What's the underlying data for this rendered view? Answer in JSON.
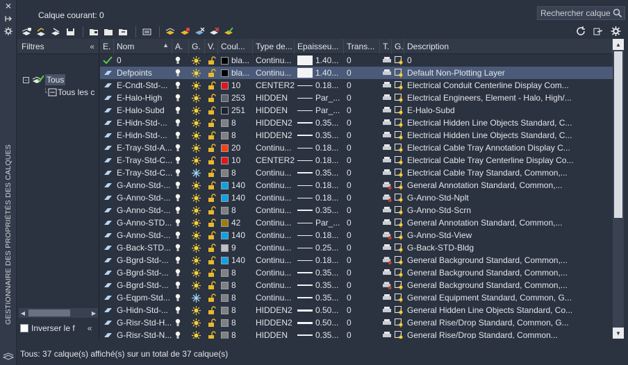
{
  "window": {
    "side_title": "GESTIONNAIRE DES PROPRIÉTÉS DES CALQUES",
    "current_layer_label": "Calque courant: 0",
    "search_placeholder": "Rechercher calque"
  },
  "filters": {
    "title": "Filtres",
    "tree": [
      {
        "label": "Tous",
        "selected": true
      },
      {
        "label": "Tous les c",
        "selected": false
      }
    ],
    "invert_label": "Inverser  le f"
  },
  "columns": [
    {
      "key": "status",
      "label": "E."
    },
    {
      "key": "name",
      "label": "Nom"
    },
    {
      "key": "on",
      "label": "A."
    },
    {
      "key": "freeze",
      "label": "G."
    },
    {
      "key": "lock",
      "label": "V."
    },
    {
      "key": "color",
      "label": "Coul..."
    },
    {
      "key": "linetype",
      "label": "Type de..."
    },
    {
      "key": "lineweight",
      "label": "Epaisseu..."
    },
    {
      "key": "transparency",
      "label": "Trans..."
    },
    {
      "key": "plot",
      "label": "T."
    },
    {
      "key": "newvp",
      "label": "G."
    },
    {
      "key": "description",
      "label": "Description"
    }
  ],
  "layers": [
    {
      "status": "current",
      "name": "0",
      "color_label": "bla...",
      "color": "#000000",
      "linetype": "Continu...",
      "lw": "1.40...",
      "lw_style": "box",
      "trans": "0",
      "plot_red": false,
      "desc": "0",
      "frozen": false
    },
    {
      "status": "layer",
      "name": "Defpoints",
      "color_label": "bla...",
      "color": "#000000",
      "linetype": "Continu...",
      "lw": "1.40...",
      "lw_style": "box",
      "trans": "0",
      "plot_red": false,
      "desc": "Default Non-Plotting Layer",
      "frozen": false,
      "selected": true
    },
    {
      "status": "layer",
      "name": "E-Cndt-Std-...",
      "color_label": "10",
      "color": "#e0151c",
      "linetype": "CENTER2",
      "lw": "0.18...",
      "lw_style": "thin",
      "trans": "0",
      "plot_red": false,
      "desc": "Electrical Conduit Centerline Display Com...",
      "frozen": false
    },
    {
      "status": "layer",
      "name": "E-Halo-High",
      "color_label": "253",
      "color": "#5e6470",
      "linetype": "HIDDEN",
      "lw": "Par_...",
      "lw_style": "thin",
      "trans": "0",
      "plot_red": false,
      "desc": "Electrical Engineers, Element - Halo, High/...",
      "frozen": false
    },
    {
      "status": "layer",
      "name": "E-Halo-Subd",
      "color_label": "251",
      "color": "#1e232b",
      "linetype": "HIDDEN",
      "lw": "Par_...",
      "lw_style": "thin",
      "trans": "0",
      "plot_red": false,
      "desc": "E-Halo-Subd",
      "frozen": false
    },
    {
      "status": "layer",
      "name": "E-Hidn-Std-...",
      "color_label": "8",
      "color": "#808080",
      "linetype": "HIDDEN2",
      "lw": "0.35...",
      "lw_style": "med",
      "trans": "0",
      "plot_red": false,
      "desc": "Electrical Hidden Line Objects Standard, C...",
      "frozen": false
    },
    {
      "status": "layer",
      "name": "E-Hidn-Std-...",
      "color_label": "8",
      "color": "#808080",
      "linetype": "HIDDEN2",
      "lw": "0.35...",
      "lw_style": "med",
      "trans": "0",
      "plot_red": false,
      "desc": "Electrical Hidden Line Objects Standard, C...",
      "frozen": false
    },
    {
      "status": "layer",
      "name": "E-Tray-Std-A...",
      "color_label": "20",
      "color": "#ff3f0f",
      "linetype": "Continu...",
      "lw": "0.18...",
      "lw_style": "thin",
      "trans": "0",
      "plot_red": false,
      "desc": "Electrical Cable Tray Annotation Display C...",
      "frozen": false
    },
    {
      "status": "layer",
      "name": "E-Tray-Std-C...",
      "color_label": "10",
      "color": "#e0151c",
      "linetype": "CENTER2",
      "lw": "0.18...",
      "lw_style": "thin",
      "trans": "0",
      "plot_red": false,
      "desc": "Electrical Cable Tray Centerline Display Co...",
      "frozen": false
    },
    {
      "status": "layer",
      "name": "E-Tray-Std-C...",
      "color_label": "8",
      "color": "#808080",
      "linetype": "Continu...",
      "lw": "0.35...",
      "lw_style": "med",
      "trans": "0",
      "plot_red": false,
      "desc": "Electrical Cable Tray Standard, Common,...",
      "frozen": true
    },
    {
      "status": "layer",
      "name": "G-Anno-Std-...",
      "color_label": "140",
      "color": "#0aa3e6",
      "linetype": "Continu...",
      "lw": "0.18...",
      "lw_style": "thin",
      "trans": "0",
      "plot_red": true,
      "desc": "General Annotation Standard, Common,...",
      "frozen": false
    },
    {
      "status": "layer",
      "name": "G-Anno-Std-...",
      "color_label": "140",
      "color": "#0aa3e6",
      "linetype": "Continu...",
      "lw": "0.18...",
      "lw_style": "thin",
      "trans": "0",
      "plot_red": true,
      "desc": "G-Anno-Std-Nplt",
      "frozen": false
    },
    {
      "status": "layer",
      "name": "G-Anno-Std-...",
      "color_label": "8",
      "color": "#808080",
      "linetype": "Continu...",
      "lw": "0.35...",
      "lw_style": "med",
      "trans": "0",
      "plot_red": false,
      "desc": "G-Anno-Std-Scrn",
      "frozen": false
    },
    {
      "status": "layer",
      "name": "G-Anno-STD...",
      "color_label": "42",
      "color": "#9c7d0c",
      "linetype": "Continu...",
      "lw": "Par_...",
      "lw_style": "thin",
      "trans": "0",
      "plot_red": false,
      "desc": "General Annotation Standard, Common,...",
      "frozen": false
    },
    {
      "status": "layer",
      "name": "G-Anno-Std-...",
      "color_label": "140",
      "color": "#0aa3e6",
      "linetype": "Continu...",
      "lw": "0.18...",
      "lw_style": "thin",
      "trans": "0",
      "plot_red": true,
      "desc": "G-Anno-Std-View",
      "frozen": false
    },
    {
      "status": "layer",
      "name": "G-Back-STD...",
      "color_label": "9",
      "color": "#c0c0c0",
      "linetype": "Continu...",
      "lw": "0.25...",
      "lw_style": "thin",
      "trans": "0",
      "plot_red": false,
      "desc": "G-Back-STD-Bldg",
      "frozen": false
    },
    {
      "status": "layer",
      "name": "G-Bgrd-Std-...",
      "color_label": "140",
      "color": "#0aa3e6",
      "linetype": "Continu...",
      "lw": "0.18...",
      "lw_style": "thin",
      "trans": "0",
      "plot_red": true,
      "desc": "General Background Standard, Common,...",
      "frozen": false
    },
    {
      "status": "layer",
      "name": "G-Bgrd-Std-...",
      "color_label": "8",
      "color": "#808080",
      "linetype": "Continu...",
      "lw": "0.35...",
      "lw_style": "med",
      "trans": "0",
      "plot_red": false,
      "desc": "General Background Standard, Common,...",
      "frozen": false
    },
    {
      "status": "layer",
      "name": "G-Bgrd-Std-...",
      "color_label": "8",
      "color": "#808080",
      "linetype": "Continu...",
      "lw": "0.35...",
      "lw_style": "med",
      "trans": "0",
      "plot_red": true,
      "desc": "General Background Standard, Common,...",
      "frozen": false
    },
    {
      "status": "layer",
      "name": "G-Eqpm-Std...",
      "color_label": "8",
      "color": "#808080",
      "linetype": "Continu...",
      "lw": "0.35...",
      "lw_style": "med",
      "trans": "0",
      "plot_red": false,
      "desc": "General Equipment Standard, Common, G...",
      "frozen": true
    },
    {
      "status": "layer",
      "name": "G-Hidn-Std-...",
      "color_label": "8",
      "color": "#808080",
      "linetype": "HIDDEN2",
      "lw": "0.50...",
      "lw_style": "thick",
      "trans": "0",
      "plot_red": false,
      "desc": "General Hidden Line Objects Standard, Co...",
      "frozen": false
    },
    {
      "status": "layer",
      "name": "G-Risr-Std-H...",
      "color_label": "8",
      "color": "#808080",
      "linetype": "HIDDEN2",
      "lw": "0.50...",
      "lw_style": "thick",
      "trans": "0",
      "plot_red": false,
      "desc": "General Rise/Drop Standard, Common, G...",
      "frozen": false
    },
    {
      "status": "layer",
      "name": "G-Risr-Std-N...",
      "color_label": "8",
      "color": "#808080",
      "linetype": "HIDDEN",
      "lw": "0.35...",
      "lw_style": "med",
      "trans": "0",
      "plot_red": false,
      "desc": "General Rise/Drop Standard, Common...",
      "frozen": false
    }
  ],
  "status_bar": "Tous: 37 calque(s) affiché(s) sur un total de 37 calque(s)"
}
